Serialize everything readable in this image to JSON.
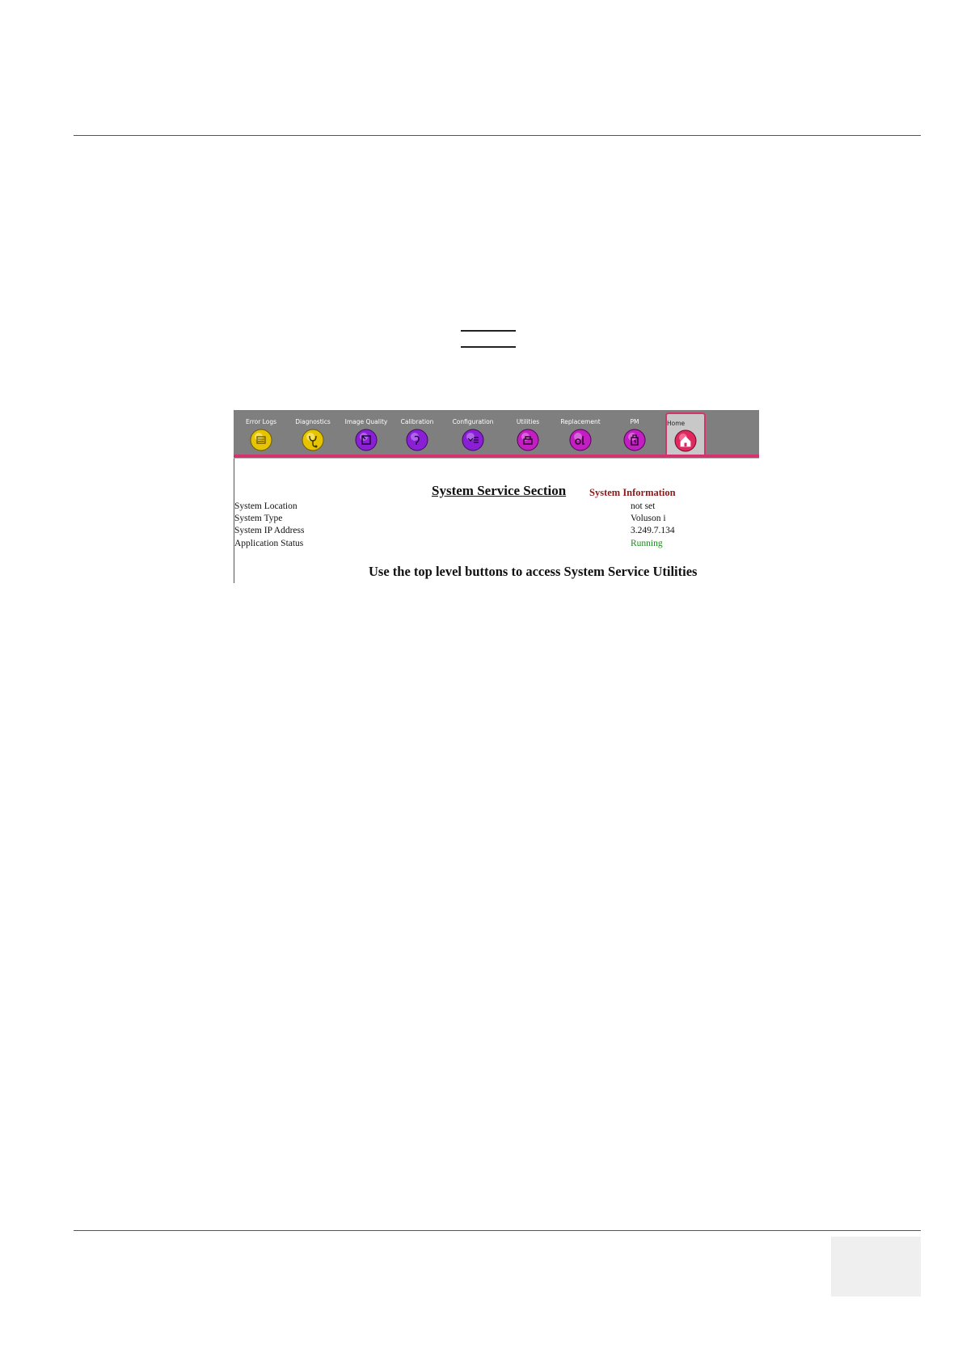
{
  "toolbar": {
    "buttons": [
      {
        "label": "Error Logs",
        "color": "#e6c400",
        "icon": "error-logs-icon"
      },
      {
        "label": "Diagnostics",
        "color": "#e6c400",
        "icon": "diagnostics-icon"
      },
      {
        "label": "Image Quality",
        "color": "#8b1fd6",
        "icon": "image-quality-icon"
      },
      {
        "label": "Calibration",
        "color": "#8b1fd6",
        "icon": "calibration-icon"
      },
      {
        "label": "Configuration",
        "color": "#8b1fd6",
        "icon": "configuration-icon"
      },
      {
        "label": "Utilities",
        "color": "#c21fc2",
        "icon": "utilities-icon"
      },
      {
        "label": "Replacement",
        "color": "#c21fc2",
        "icon": "replacement-icon"
      },
      {
        "label": "PM",
        "color": "#c21fc2",
        "icon": "pm-icon"
      }
    ],
    "home": {
      "label": "Home",
      "color": "#e0285f",
      "icon": "home-icon"
    },
    "accent": "#d4336e"
  },
  "content": {
    "title": "System Service Section",
    "subtitle": "System Information",
    "rows": [
      {
        "label": "System Location",
        "value": "not set"
      },
      {
        "label": "System Type",
        "value": "Voluson i"
      },
      {
        "label": "System IP Address",
        "value": "3.249.7.134"
      },
      {
        "label": "Application Status",
        "value": "Running"
      }
    ],
    "footer": "Use the top level buttons to access System Service Utilities"
  }
}
